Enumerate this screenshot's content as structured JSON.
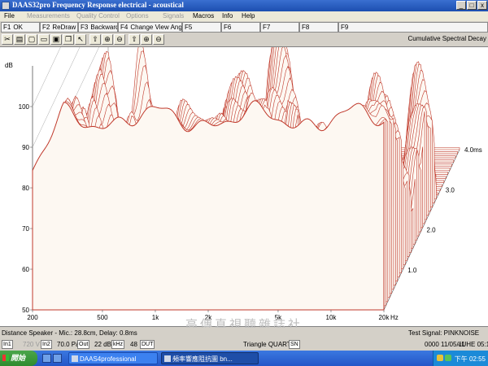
{
  "window": {
    "title": "DAAS32pro Frequency Response electrical - acoustical",
    "controls": {
      "minimize": "_",
      "maximize": "□",
      "close": "x"
    }
  },
  "menu": {
    "items": [
      {
        "label": "File",
        "enabled": true
      },
      {
        "label": "Measurements",
        "enabled": false
      },
      {
        "label": "Quality Control",
        "enabled": false
      },
      {
        "label": "Options",
        "enabled": false
      },
      {
        "label": "Signals",
        "enabled": false
      },
      {
        "label": "Macros",
        "enabled": true
      },
      {
        "label": "Info",
        "enabled": true
      },
      {
        "label": "Help",
        "enabled": true
      }
    ]
  },
  "function_keys": [
    {
      "key": "F1",
      "label": "OK"
    },
    {
      "key": "F2",
      "label": "ReDraw"
    },
    {
      "key": "F3",
      "label": "Backward"
    },
    {
      "key": "F4",
      "label": "Change View Angle"
    },
    {
      "key": "F5",
      "label": ""
    },
    {
      "key": "F6",
      "label": ""
    },
    {
      "key": "F7",
      "label": ""
    },
    {
      "key": "F8",
      "label": ""
    },
    {
      "key": "F9",
      "label": ""
    }
  ],
  "toolbar": {
    "icons": [
      "cut-icon",
      "print-icon",
      "page-icon",
      "open-folder-icon",
      "save-icon",
      "copy-icon",
      "arrow-pointer-icon",
      "up-arrow-icon",
      "zoom-in-icon",
      "zoom-out-icon",
      "up-arrow-icon",
      "zoom-in-icon",
      "zoom-out-icon"
    ],
    "plot_label": "Cumulative Spectral Decay"
  },
  "chart_data": {
    "type": "waterfall",
    "title": "Cumulative Spectral Decay",
    "watermark": "DAAS",
    "ylabel": "dB",
    "y_ticks": [
      100,
      90,
      80,
      70,
      60,
      50
    ],
    "ylim": [
      50,
      110
    ],
    "x_ticks": [
      "200",
      "500",
      "1k",
      "2k",
      "5k",
      "10k",
      "20k"
    ],
    "x_unit": "Hz",
    "x_scale": "log",
    "xlim": [
      200,
      20000
    ],
    "time_ticks": [
      "1.0",
      "2.0",
      "3.0",
      "4.0ms"
    ],
    "time_range_ms": [
      0,
      4.0
    ],
    "slices": 40,
    "line_color": "#c0392b",
    "grid": true
  },
  "status": {
    "distance_label": "Distance Speaker - Mic.: 28.8cm, Delay: 0.8ms",
    "test_signal_label": "Test Signal: PINKNOISE",
    "row2": {
      "in1": "In1",
      "v720": "720 V",
      "in2": "In2",
      "pa": "70.0 Pa",
      "out": "Out",
      "db": "22 dB",
      "unit": "kHz",
      "n48": "48",
      "dut": "DUT",
      "triangle": "Triangle QUARTET",
      "sn": "SN",
      "date": "0000 11/05/11",
      "uhe": "«UHE 05:12:39"
    }
  },
  "watermark_text": "高傳真視聽雜誌社",
  "taskbar": {
    "start_label": "開始",
    "tasks": [
      {
        "label": "DAAS4professional",
        "active": false
      },
      {
        "label": "頻率響應阻抗圖 bn...",
        "active": true
      }
    ],
    "clock": "下午 02:55"
  }
}
